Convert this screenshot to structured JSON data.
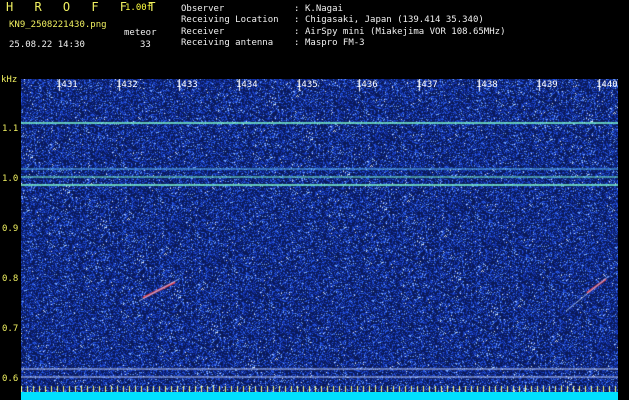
{
  "header": {
    "app_title": "H R O F F T",
    "version": "1.00f",
    "filename": "KN9_2508221430.png",
    "meteor_label": "meteor",
    "timestamp": "25.08.22 14:30",
    "meteor_count": "33"
  },
  "metadata": [
    {
      "key": "Observer",
      "value": "K.Nagai"
    },
    {
      "key": "Receiving Location",
      "value": "Chigasaki, Japan (139.414 35.340)"
    },
    {
      "key": "Receiver",
      "value": "AirSpy mini (Miakejima VOR 108.65MHz)"
    },
    {
      "key": "Receiving antenna",
      "value": "Maspro FM-3"
    }
  ],
  "separator": ":",
  "axes": {
    "y_unit": "kHz",
    "y_ticks": [
      "1.1",
      "1.0",
      "0.9",
      "0.8",
      "0.7",
      "0.6"
    ],
    "x_ticks": [
      "1431",
      "1432",
      "1433",
      "1434",
      "1435",
      "1436",
      "1437",
      "1438",
      "1439",
      "1440"
    ]
  },
  "colors": {
    "background": "#0a1a5a",
    "noise": "#3060ff",
    "carrier": "#80ffd0",
    "meteor": "#ff4040",
    "accent": "#ffff40"
  }
}
